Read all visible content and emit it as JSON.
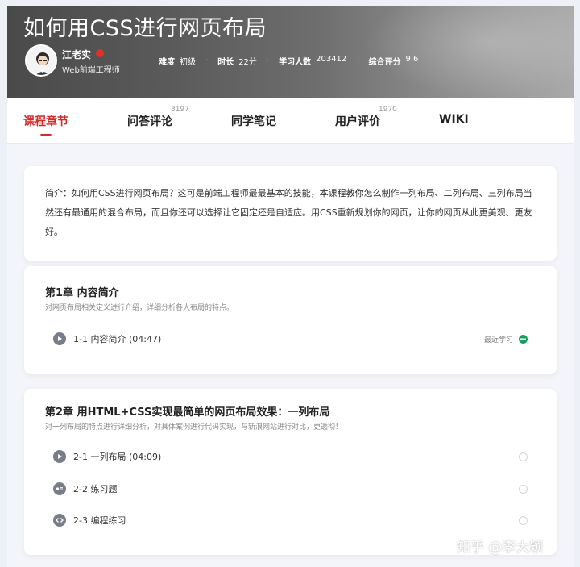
{
  "header": {
    "course_title": "如何用CSS进行网页布局",
    "teacher_name": "江老实",
    "teacher_title": "Web前端工程师",
    "stats": [
      {
        "label": "难度",
        "value": "初级"
      },
      {
        "label": "时长",
        "value": "22分"
      },
      {
        "label": "学习人数",
        "value": "203412"
      },
      {
        "label": "综合评分",
        "value": "9.6"
      }
    ]
  },
  "tabs": [
    {
      "label": "课程章节",
      "count": ""
    },
    {
      "label": "问答评论",
      "count": "3197"
    },
    {
      "label": "同学笔记",
      "count": ""
    },
    {
      "label": "用户评价",
      "count": "1970"
    },
    {
      "label": "WIKI",
      "count": ""
    }
  ],
  "intro": {
    "text": "简介：如何用CSS进行网页布局？这可是前端工程师最最基本的技能，本课程教你怎么制作一列布局、二列布局、三列布局当然还有最通用的混合布局，而且你还可以选择让它固定还是自适应。用CSS重新规划你的网页，让你的网页从此更美观、更友好。"
  },
  "chapters": [
    {
      "title": "第1章 内容简介",
      "desc": "对网页布局相关定义进行介绍，详细分析各大布局的特点。",
      "lessons": [
        {
          "label": "1-1 内容简介 (04:47)",
          "icon": "play-icon",
          "recent": "最近学习",
          "status": "done"
        }
      ]
    },
    {
      "title": "第2章 用HTML+CSS实现最简单的网页布局效果：一列布局",
      "desc": "对一列布局的特点进行详细分析，对具体案例进行代码实现，与新浪网站进行对比，更透彻！",
      "lessons": [
        {
          "label": "2-1 一列布局 (04:09)",
          "icon": "play-icon",
          "status": "empty"
        },
        {
          "label": "2-2 练习题",
          "icon": "quiz-icon",
          "status": "empty"
        },
        {
          "label": "2-3 编程练习",
          "icon": "code-icon",
          "status": "empty"
        }
      ]
    }
  ],
  "watermark": "知乎 @李大颖",
  "colors": {
    "accent": "#d52b2b",
    "done": "#17a05d",
    "icon": "#787d8a"
  }
}
